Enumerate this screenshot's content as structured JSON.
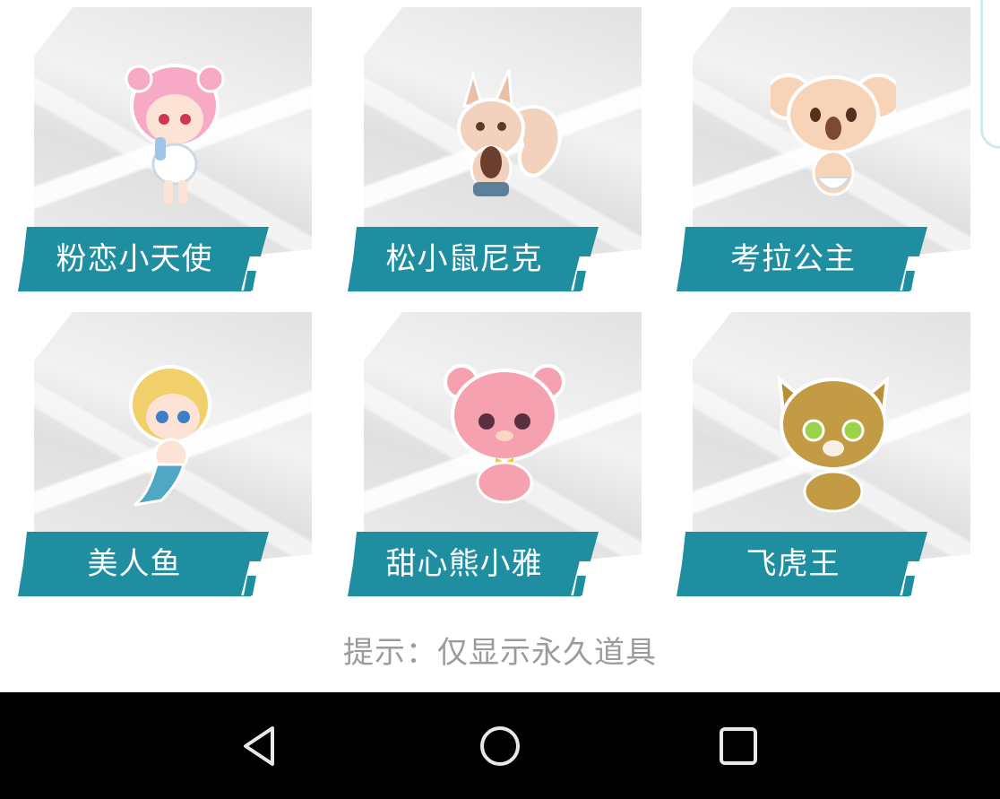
{
  "cards": [
    {
      "label": "粉恋小天使",
      "icon": "pink-angel-character-icon"
    },
    {
      "label": "松小鼠尼克",
      "icon": "squirrel-character-icon"
    },
    {
      "label": "考拉公主",
      "icon": "koala-character-icon"
    },
    {
      "label": "美人鱼",
      "icon": "mermaid-character-icon"
    },
    {
      "label": "甜心熊小雅",
      "icon": "pink-bear-character-icon"
    },
    {
      "label": "飞虎王",
      "icon": "tiger-character-icon"
    }
  ],
  "hint": "提示：仅显示永久道具",
  "colors": {
    "banner": "#1f8ea1",
    "hint": "#9b9b9b",
    "navbar": "#000000"
  },
  "navbar": {
    "back": "back-icon",
    "home": "home-icon",
    "recents": "recents-icon"
  }
}
